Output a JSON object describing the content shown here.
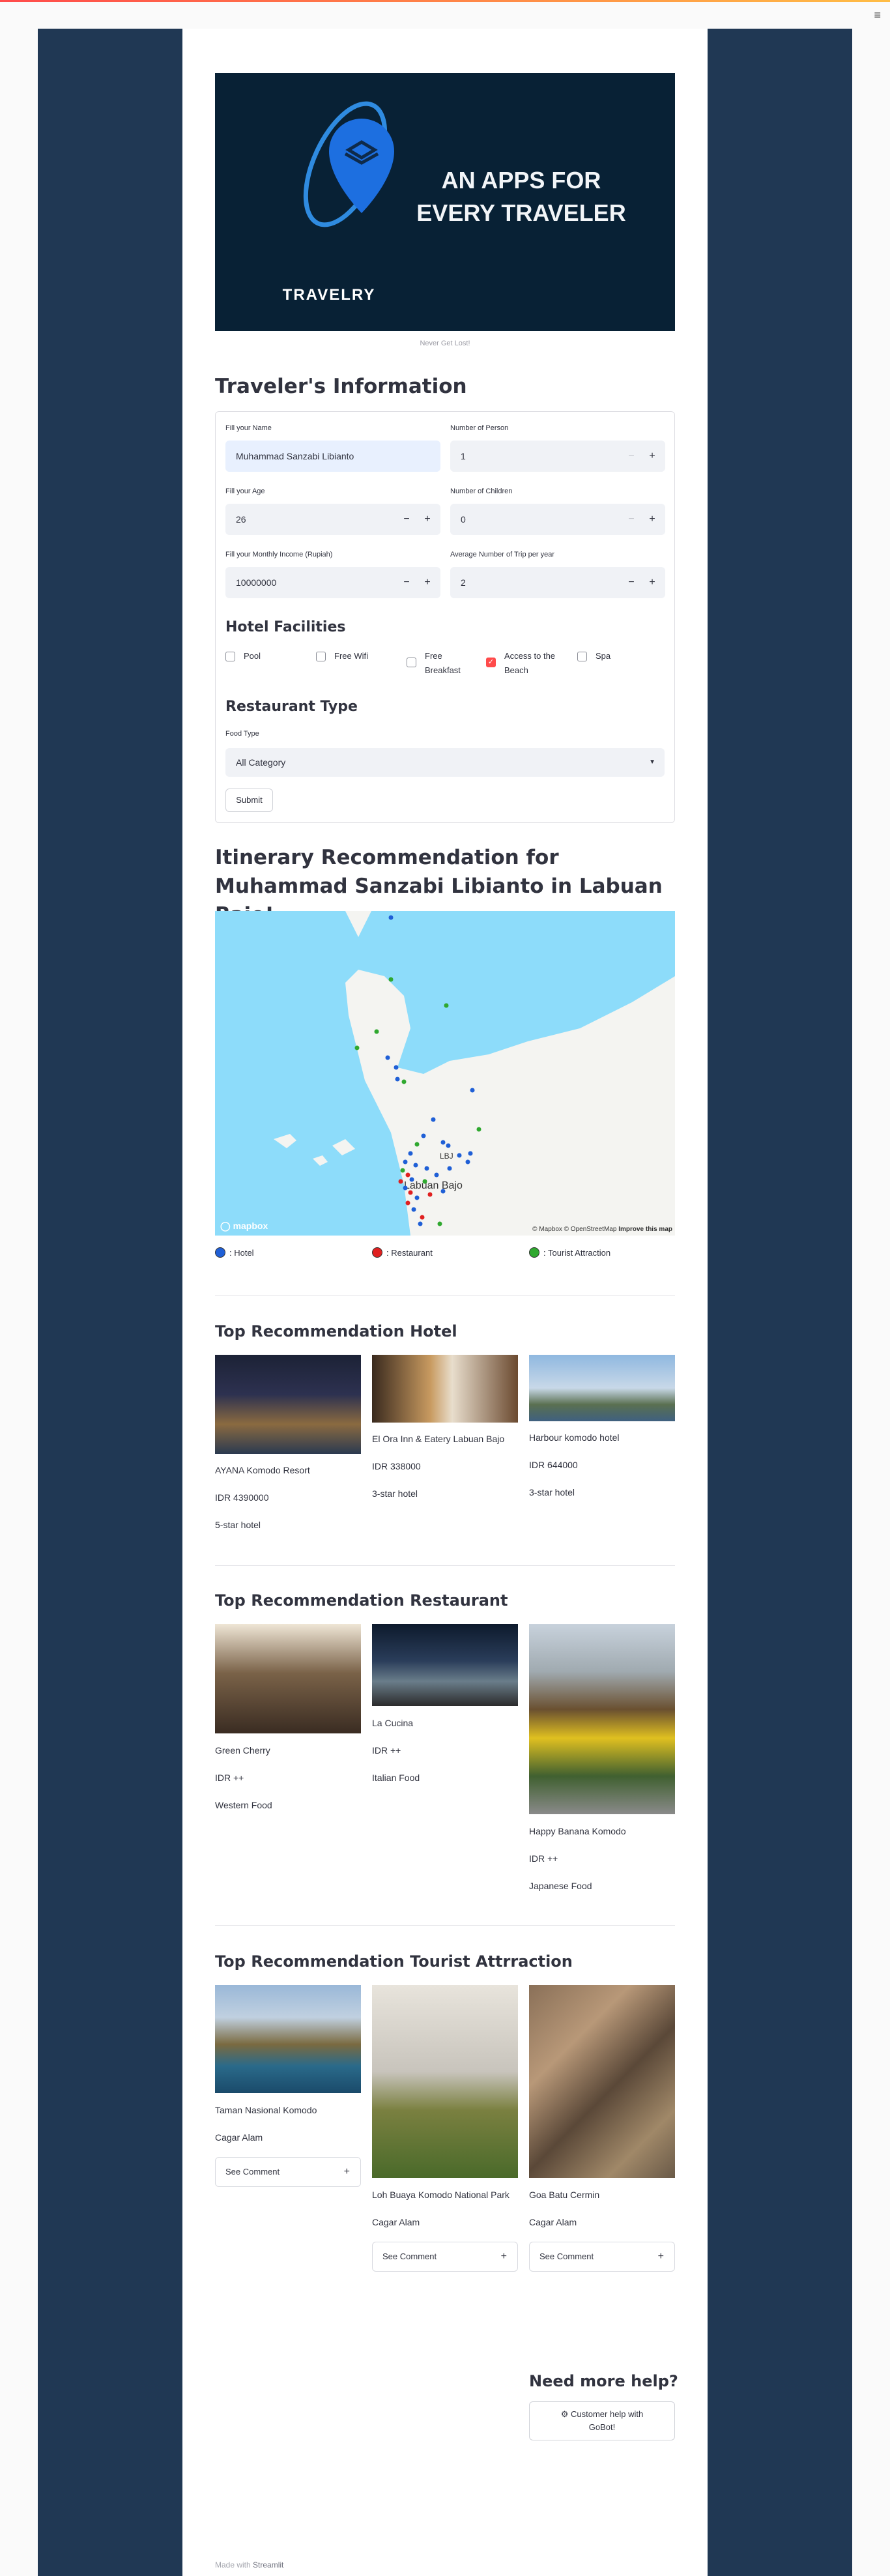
{
  "header": {
    "menu_icon": "hamburger-icon"
  },
  "hero": {
    "headline_line1": "AN APPS FOR",
    "headline_line2": "EVERY TRAVELER",
    "logo_text": "TRAVELRY",
    "caption": "Never Get Lost!"
  },
  "form": {
    "title": "Traveler's Information",
    "name": {
      "label": "Fill your Name",
      "value": "Muhammad Sanzabi Libianto"
    },
    "persons": {
      "label": "Number of Person",
      "value": "1"
    },
    "age": {
      "label": "Fill your Age",
      "value": "26"
    },
    "children": {
      "label": "Number of Children",
      "value": "0"
    },
    "income": {
      "label": "Fill your Monthly Income (Rupiah)",
      "value": "10000000"
    },
    "trips": {
      "label": "Average Number of Trip per year",
      "value": "2"
    },
    "facilities_title": "Hotel Facilities",
    "facilities": [
      {
        "label": "Pool",
        "checked": false
      },
      {
        "label": "Free Wifi",
        "checked": false
      },
      {
        "label": "Free Breakfast",
        "checked": false
      },
      {
        "label": "Access to the Beach",
        "checked": true
      },
      {
        "label": "Spa",
        "checked": false
      }
    ],
    "restaurant_title": "Restaurant Type",
    "food_type": {
      "label": "Food Type",
      "value": "All Category"
    },
    "submit_label": "Submit"
  },
  "itinerary": {
    "title": "Itinerary Recommendation for Muhammad Sanzabi Libianto in Labuan Bajo!",
    "map": {
      "place_label": "Labuan Bajo",
      "airport_label": "LBJ",
      "attribution": "© Mapbox © OpenStreetMap",
      "improve": "Improve this map",
      "logo": "mapbox"
    },
    "legend": [
      {
        "label": ": Hotel",
        "color": "#1f5fd6"
      },
      {
        "label": ": Restaurant",
        "color": "#e02020"
      },
      {
        "label": ": Tourist Attraction",
        "color": "#2fa82f"
      }
    ]
  },
  "hotels": {
    "title": "Top Recommendation Hotel",
    "items": [
      {
        "name": "AYANA Komodo Resort",
        "price": "IDR 4390000",
        "stars": "5-star hotel"
      },
      {
        "name": "El Ora Inn & Eatery Labuan Bajo",
        "price": "IDR 338000",
        "stars": "3-star hotel"
      },
      {
        "name": "Harbour komodo hotel",
        "price": "IDR 644000",
        "stars": "3-star hotel"
      }
    ]
  },
  "restaurants": {
    "title": "Top Recommendation Restaurant",
    "items": [
      {
        "name": "Green Cherry",
        "price": "IDR ++",
        "type": "Western Food"
      },
      {
        "name": "La Cucina",
        "price": "IDR ++",
        "type": "Italian Food"
      },
      {
        "name": "Happy Banana Komodo",
        "price": "IDR ++",
        "type": "Japanese Food"
      }
    ]
  },
  "attractions": {
    "title": "Top Recommendation Tourist Attrraction",
    "items": [
      {
        "name": "Taman Nasional Komodo",
        "category": "Cagar Alam",
        "comment_label": "See Comment"
      },
      {
        "name": "Loh Buaya Komodo National Park",
        "category": "Cagar Alam",
        "comment_label": "See Comment"
      },
      {
        "name": "Goa Batu Cermin",
        "category": "Cagar Alam",
        "comment_label": "See Comment"
      }
    ]
  },
  "help": {
    "title": "Need more help?",
    "button_line1": "Customer help with",
    "button_line2": "GoBot!",
    "button_icon": "robot-icon"
  },
  "footer": {
    "prefix": "Made with",
    "brand": "Streamlit"
  }
}
